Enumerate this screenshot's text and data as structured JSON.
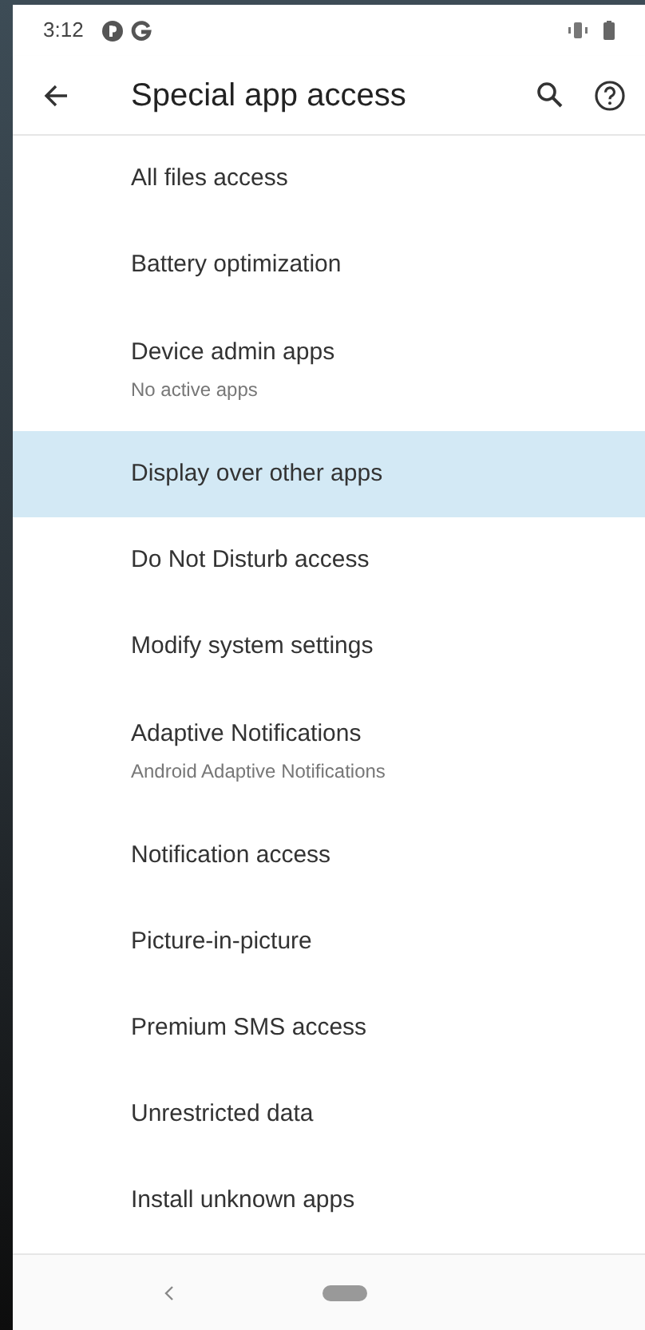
{
  "status_bar": {
    "time": "3:12"
  },
  "toolbar": {
    "title": "Special app access"
  },
  "items": [
    {
      "title": "All files access",
      "selected": false
    },
    {
      "title": "Battery optimization",
      "selected": false
    },
    {
      "title": "Device admin apps",
      "subtitle": "No active apps",
      "selected": false
    },
    {
      "title": "Display over other apps",
      "selected": true
    },
    {
      "title": "Do Not Disturb access",
      "selected": false
    },
    {
      "title": "Modify system settings",
      "selected": false
    },
    {
      "title": "Adaptive Notifications",
      "subtitle": "Android Adaptive Notifications",
      "selected": false
    },
    {
      "title": "Notification access",
      "selected": false
    },
    {
      "title": "Picture-in-picture",
      "selected": false
    },
    {
      "title": "Premium SMS access",
      "selected": false
    },
    {
      "title": "Unrestricted data",
      "selected": false
    },
    {
      "title": "Install unknown apps",
      "selected": false
    }
  ]
}
